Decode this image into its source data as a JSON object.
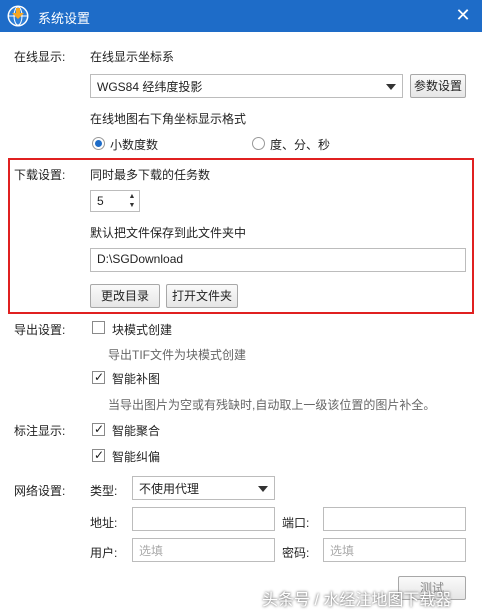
{
  "window": {
    "title": "系统设置"
  },
  "online_display": {
    "label": "在线显示:",
    "coord_system_label": "在线显示坐标系",
    "coord_system_value": "WGS84 经纬度投影",
    "param_button": "参数设置",
    "format_label": "在线地图右下角坐标显示格式",
    "format_options": [
      "小数度数",
      "度、分、秒"
    ],
    "format_selected": "小数度数"
  },
  "download": {
    "label": "下载设置:",
    "max_tasks_label": "同时最多下载的任务数",
    "max_tasks_value": "5",
    "folder_label": "默认把文件保存到此文件夹中",
    "folder_value": "D:\\SGDownload",
    "change_dir_button": "更改目录",
    "open_folder_button": "打开文件夹"
  },
  "export": {
    "label": "导出设置:",
    "block_mode_label": "块模式创建",
    "block_mode_checked": false,
    "block_mode_hint": "导出TIF文件为块模式创建",
    "smart_fill_label": "智能补图",
    "smart_fill_checked": true,
    "smart_fill_hint": "当导出图片为空或有残缺时,自动取上一级该位置的图片补全。"
  },
  "annotation": {
    "label": "标注显示:",
    "smart_merge_label": "智能聚合",
    "smart_merge_checked": true,
    "smart_correct_label": "智能纠偏",
    "smart_correct_checked": true
  },
  "network": {
    "label": "网络设置:",
    "type_label": "类型:",
    "type_value": "不使用代理",
    "address_label": "地址:",
    "address_value": "",
    "port_label": "端口:",
    "port_value": "",
    "user_label": "用户:",
    "user_placeholder": "选填",
    "password_label": "密码:",
    "password_placeholder": "选填",
    "test_button": "测试"
  },
  "watermark": "头条号 / 水经注地图下载器",
  "colors": {
    "titlebar": "#1e6cc8",
    "highlight": "#e02020"
  }
}
